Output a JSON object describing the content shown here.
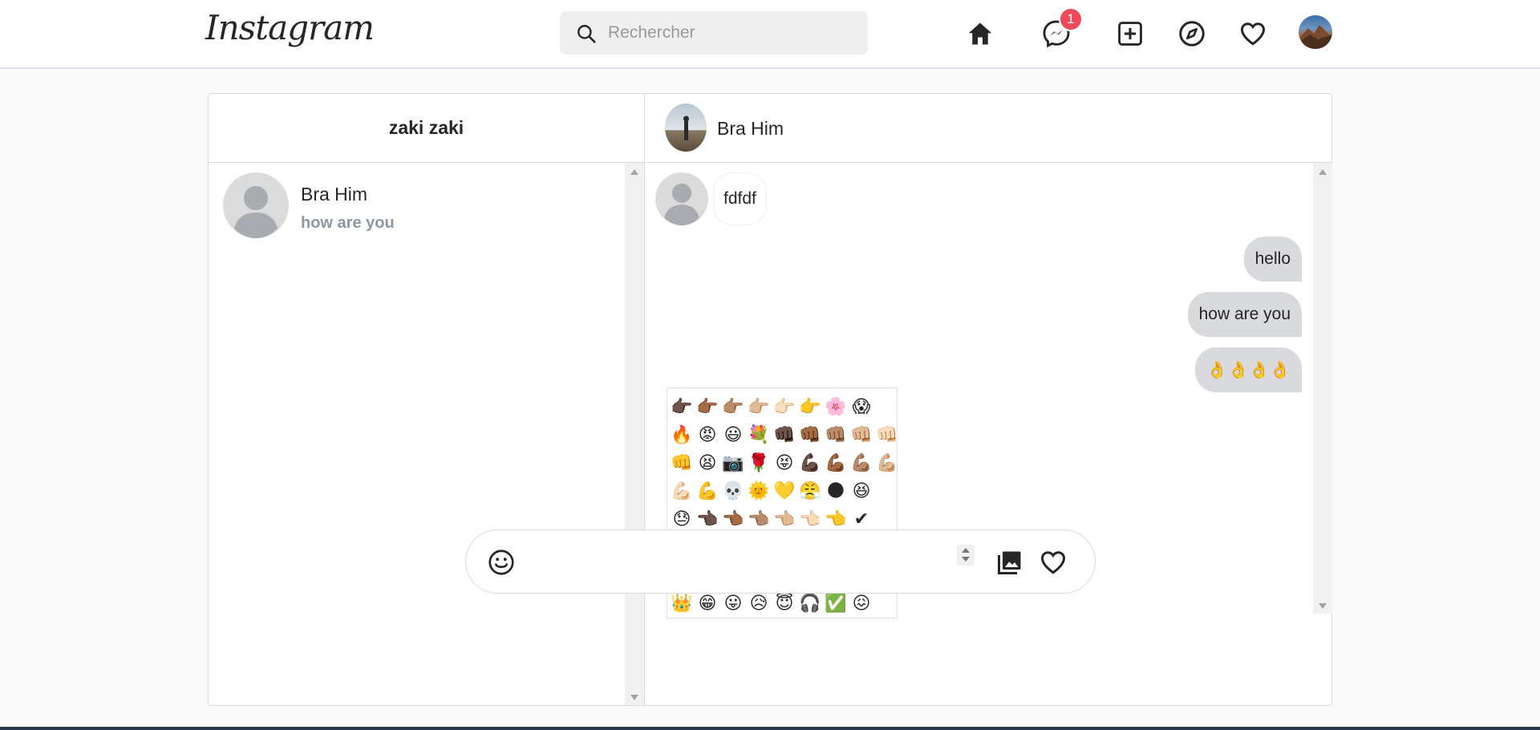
{
  "app": {
    "logo": "Instagram"
  },
  "header": {
    "search_placeholder": "Rechercher",
    "messages_badge": "1",
    "icons": [
      "home-icon",
      "messenger-icon",
      "new-post-icon",
      "explore-icon",
      "activity-heart-icon",
      "profile-avatar"
    ]
  },
  "inbox": {
    "username": "zaki zaki",
    "conversations": [
      {
        "name": "Bra Him",
        "last_message": "how are you"
      }
    ]
  },
  "chat": {
    "contact_name": "Bra Him",
    "messages": [
      {
        "direction": "in",
        "text": "fdfdf"
      },
      {
        "direction": "out",
        "text": "hello"
      },
      {
        "direction": "out",
        "text": "how are you"
      },
      {
        "direction": "out",
        "text": "👌👌👌👌"
      }
    ],
    "emoji_picker": {
      "rows": [
        [
          "👉🏿",
          "👉🏾",
          "👉🏽",
          "👉🏼",
          "👉🏻",
          "👉",
          "🌸",
          "😱"
        ],
        [
          "🔥",
          "😡",
          "😃",
          "💐",
          "👊🏿",
          "👊🏾",
          "👊🏽",
          "👊🏼",
          "👊🏻"
        ],
        [
          "👊",
          "😫",
          "📷",
          "🌹",
          "😝",
          "💪🏿",
          "💪🏾",
          "💪🏽",
          "💪🏼"
        ],
        [
          "💪🏻",
          "💪",
          "💀",
          "🌞",
          "💛",
          "😤",
          "🌑",
          "😆"
        ],
        [
          "😓",
          "👈🏿",
          "👈🏾",
          "👈🏽",
          "👈🏼",
          "👈🏻",
          "👈",
          "✔"
        ],
        [
          "😻",
          "😀",
          "😌",
          "💚",
          "👋🏿",
          "👋🏾",
          "👋🏽",
          "👋🏼"
        ],
        [
          "👋🏻",
          "👋",
          "😣",
          "❤",
          "▶",
          "◀",
          "↪",
          "↩"
        ],
        [
          "👑",
          "😁",
          "😛",
          "😥",
          "😇",
          "🎧",
          "✅",
          "😖"
        ]
      ]
    }
  },
  "colors": {
    "badge": "#ed4956",
    "outgoing_bubble": "#d8dadd",
    "secondary_text": "#8e97a6"
  }
}
